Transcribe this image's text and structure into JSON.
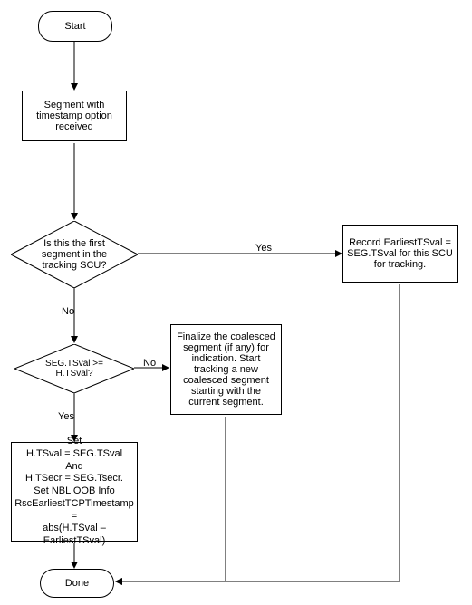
{
  "chart_data": {
    "type": "flowchart",
    "nodes": [
      {
        "id": "start",
        "type": "terminator",
        "label": "Start"
      },
      {
        "id": "seg_recv",
        "type": "process",
        "label": "Segment with timestamp option received"
      },
      {
        "id": "first_seg_q",
        "type": "decision",
        "label": "Is this the first segment in the tracking SCU?"
      },
      {
        "id": "record_earliest",
        "type": "process",
        "label": "Record EarliestTSval  = SEG.TSval for this SCU for tracking."
      },
      {
        "id": "tsval_cmp_q",
        "type": "decision",
        "label": "SEG.TSval  >= H.TSval?"
      },
      {
        "id": "finalize",
        "type": "process",
        "label": "Finalize the coalesced segment (if any) for indication. Start tracking a new coalesced segment starting with the current segment."
      },
      {
        "id": "set_vals",
        "type": "process",
        "label": "Set\nH.TSval = SEG.TSval\nAnd\nH.TSecr = SEG.Tsecr.\n\nSet NBL OOB Info RscEarliestTCPTimestamp = abs(H.TSval – EarliestTSval)"
      },
      {
        "id": "done",
        "type": "terminator",
        "label": "Done"
      }
    ],
    "edges": [
      {
        "from": "start",
        "to": "seg_recv"
      },
      {
        "from": "seg_recv",
        "to": "first_seg_q"
      },
      {
        "from": "first_seg_q",
        "to": "record_earliest",
        "label": "Yes"
      },
      {
        "from": "first_seg_q",
        "to": "tsval_cmp_q",
        "label": "No"
      },
      {
        "from": "tsval_cmp_q",
        "to": "finalize",
        "label": "No"
      },
      {
        "from": "tsval_cmp_q",
        "to": "set_vals",
        "label": "Yes"
      },
      {
        "from": "set_vals",
        "to": "done"
      },
      {
        "from": "finalize",
        "to": "done"
      },
      {
        "from": "record_earliest",
        "to": "done"
      }
    ]
  },
  "start": "Start",
  "seg_recv": "Segment with timestamp option received",
  "first_seg_q": "Is this the first segment in the tracking SCU?",
  "record_earliest": "Record EarliestTSval  = SEG.TSval for this SCU for tracking.",
  "tsval_cmp_q": "SEG.TSval  >= H.TSval?",
  "finalize": "Finalize the coalesced segment (if any) for indication. Start tracking a new coalesced segment starting with the current segment.",
  "set_line1": "Set",
  "set_line2": "H.TSval = SEG.TSval",
  "set_line3": "And",
  "set_line4": "H.TSecr = SEG.Tsecr.",
  "set_line5": "Set NBL OOB Info",
  "set_line6": "RscEarliestTCPTimestamp =",
  "set_line7": "abs(H.TSval – EarliestTSval)",
  "done": "Done",
  "yes": "Yes",
  "no": "No"
}
